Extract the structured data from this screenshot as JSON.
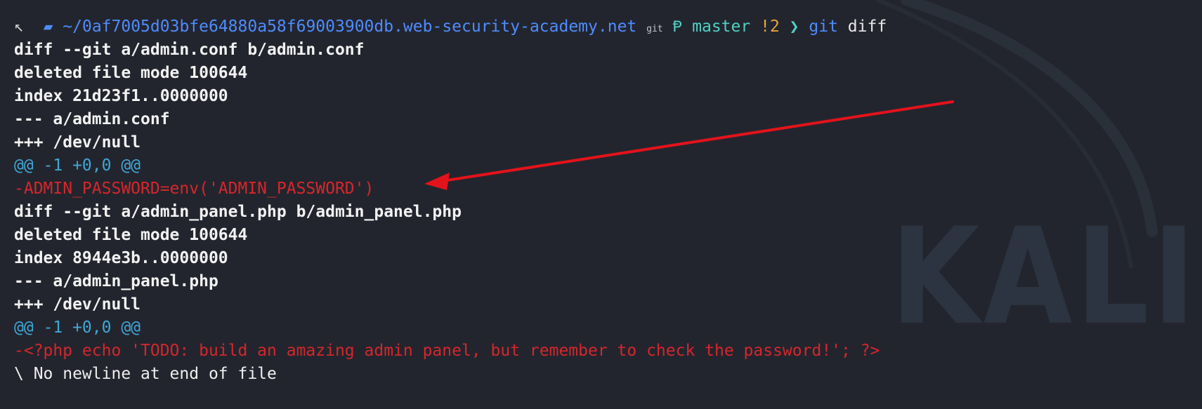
{
  "prompt": {
    "glyph": "↖",
    "folder_icon": "folder-icon",
    "path": "~/0af7005d03bfe64880a58f69003900db.web-security-academy.net",
    "git_glyph": "git",
    "branch_icon": "Ᵽ",
    "branch": "master",
    "dirty": "!2",
    "chevron": "❯",
    "command": "git",
    "argument": "diff"
  },
  "diff_lines": [
    {
      "kind": "meta",
      "text": "diff --git a/admin.conf b/admin.conf"
    },
    {
      "kind": "meta",
      "text": "deleted file mode 100644"
    },
    {
      "kind": "meta",
      "text": "index 21d23f1..0000000"
    },
    {
      "kind": "meta",
      "text": "--- a/admin.conf"
    },
    {
      "kind": "meta",
      "text": "+++ /dev/null"
    },
    {
      "kind": "hunk",
      "text": "@@ -1 +0,0 @@"
    },
    {
      "kind": "removed",
      "text": "-ADMIN_PASSWORD=env('ADMIN_PASSWORD')"
    },
    {
      "kind": "meta",
      "text": "diff --git a/admin_panel.php b/admin_panel.php"
    },
    {
      "kind": "meta",
      "text": "deleted file mode 100644"
    },
    {
      "kind": "meta",
      "text": "index 8944e3b..0000000"
    },
    {
      "kind": "meta",
      "text": "--- a/admin_panel.php"
    },
    {
      "kind": "meta",
      "text": "+++ /dev/null"
    },
    {
      "kind": "hunk",
      "text": "@@ -1 +0,0 @@"
    },
    {
      "kind": "removed",
      "text": "-<?php echo 'TODO: build an amazing admin panel, but remember to check the password!'; ?>"
    },
    {
      "kind": "plain",
      "text": "\\ No newline at end of file"
    }
  ],
  "watermark": "KALI",
  "colors": {
    "background": "#23252e",
    "removed": "#d6262b",
    "hunk": "#3fa7d6",
    "path": "#4e8cff",
    "branch": "#4fd1c5",
    "dirty": "#e8a33d",
    "annotation_arrow": "#e3131b"
  }
}
